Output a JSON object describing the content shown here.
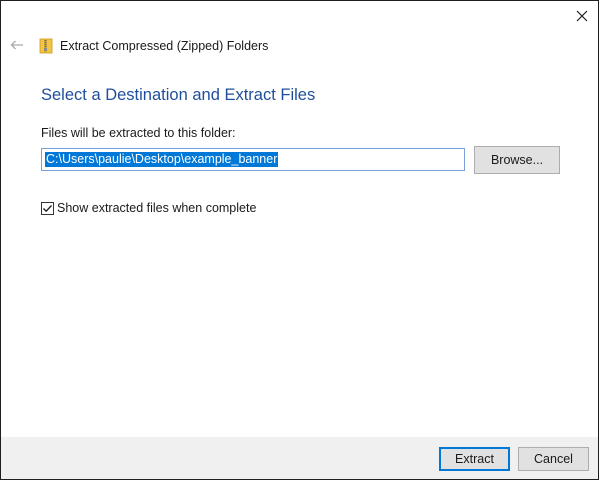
{
  "window": {
    "title": "Extract Compressed (Zipped) Folders",
    "close_icon": "close-icon",
    "back_icon": "back-arrow-icon",
    "title_icon": "zip-folder-icon"
  },
  "main": {
    "heading": "Select a Destination and Extract Files",
    "field_label": "Files will be extracted to this folder:",
    "path_value": "C:\\Users\\paulie\\Desktop\\example_banner",
    "browse_label": "Browse...",
    "show_files_label": "Show extracted files when complete",
    "show_files_checked": true
  },
  "footer": {
    "extract_label": "Extract",
    "cancel_label": "Cancel"
  },
  "colors": {
    "heading": "#1f4e9c",
    "selection": "#0078d7",
    "footer_bg": "#f0f0f0"
  }
}
